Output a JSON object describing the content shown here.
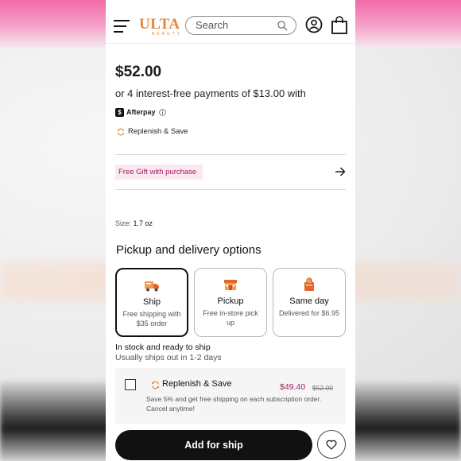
{
  "header": {
    "logo": "ULTA",
    "logo_sub": "BEAUTY",
    "search_placeholder": "Search",
    "icons": [
      "menu-icon",
      "search-icon",
      "account-icon",
      "bag-icon"
    ]
  },
  "product": {
    "price": "$52.00",
    "installments": "or 4 interest-free payments of $13.00 with",
    "afterpay_label": "Afterpay",
    "replenish_label": "Replenish & Save",
    "gift_badge": "Free Gift with purchase",
    "size_label": "Size:",
    "size_value": "1.7 oz"
  },
  "pickup": {
    "title": "Pickup and delivery options",
    "options": [
      {
        "title": "Ship",
        "desc": "Free shipping with $35 order",
        "icon": "truck-icon",
        "selected": true
      },
      {
        "title": "Pickup",
        "desc": "Free in-store pick up",
        "icon": "store-icon",
        "selected": false
      },
      {
        "title": "Same day",
        "desc": "Delivered for $6.95",
        "icon": "bag-delivery-icon",
        "selected": false
      }
    ],
    "stock_status": "In stock and ready to ship",
    "ships_out": "Usually ships out in 1-2 days"
  },
  "subscription": {
    "title": "Replenish & Save",
    "price": "$49.40",
    "old_price": "$52.00",
    "description": "Save 5% and get free shipping on each subscription order. Cancel anytime!",
    "checked": false
  },
  "footer": {
    "add_button_label": "Add for ship"
  },
  "colors": {
    "brand_orange": "#e08a3c",
    "accent_magenta": "#a31b5c",
    "button_dark": "#111111"
  }
}
